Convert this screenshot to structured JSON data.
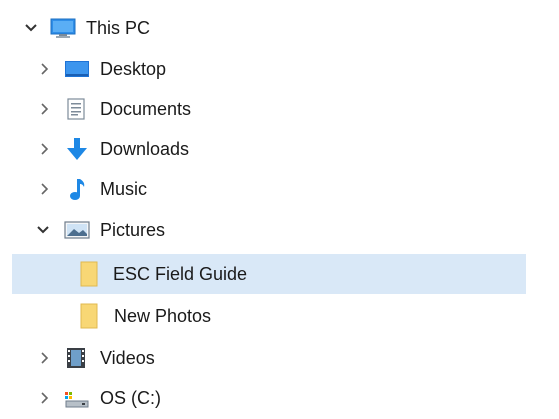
{
  "tree": {
    "this_pc": {
      "label": "This PC",
      "expanded": true,
      "icon": "monitor-icon"
    },
    "items": [
      {
        "label": "Desktop",
        "expanded": false,
        "icon": "desktop-icon"
      },
      {
        "label": "Documents",
        "expanded": false,
        "icon": "documents-icon"
      },
      {
        "label": "Downloads",
        "expanded": false,
        "icon": "download-arrow-icon"
      },
      {
        "label": "Music",
        "expanded": false,
        "icon": "music-note-icon"
      },
      {
        "label": "Pictures",
        "expanded": true,
        "icon": "pictures-icon"
      },
      {
        "label": "Videos",
        "expanded": false,
        "icon": "film-icon"
      },
      {
        "label": "OS (C:)",
        "expanded": false,
        "icon": "drive-icon"
      }
    ],
    "pictures_children": [
      {
        "label": "ESC Field Guide",
        "selected": true,
        "icon": "folder-icon"
      },
      {
        "label": "New Photos",
        "selected": false,
        "icon": "folder-icon"
      }
    ]
  },
  "colors": {
    "selection": "#d9e8f7",
    "chevron": "#555555",
    "folder": "#f8d775",
    "accent_blue": "#1e88e5"
  }
}
